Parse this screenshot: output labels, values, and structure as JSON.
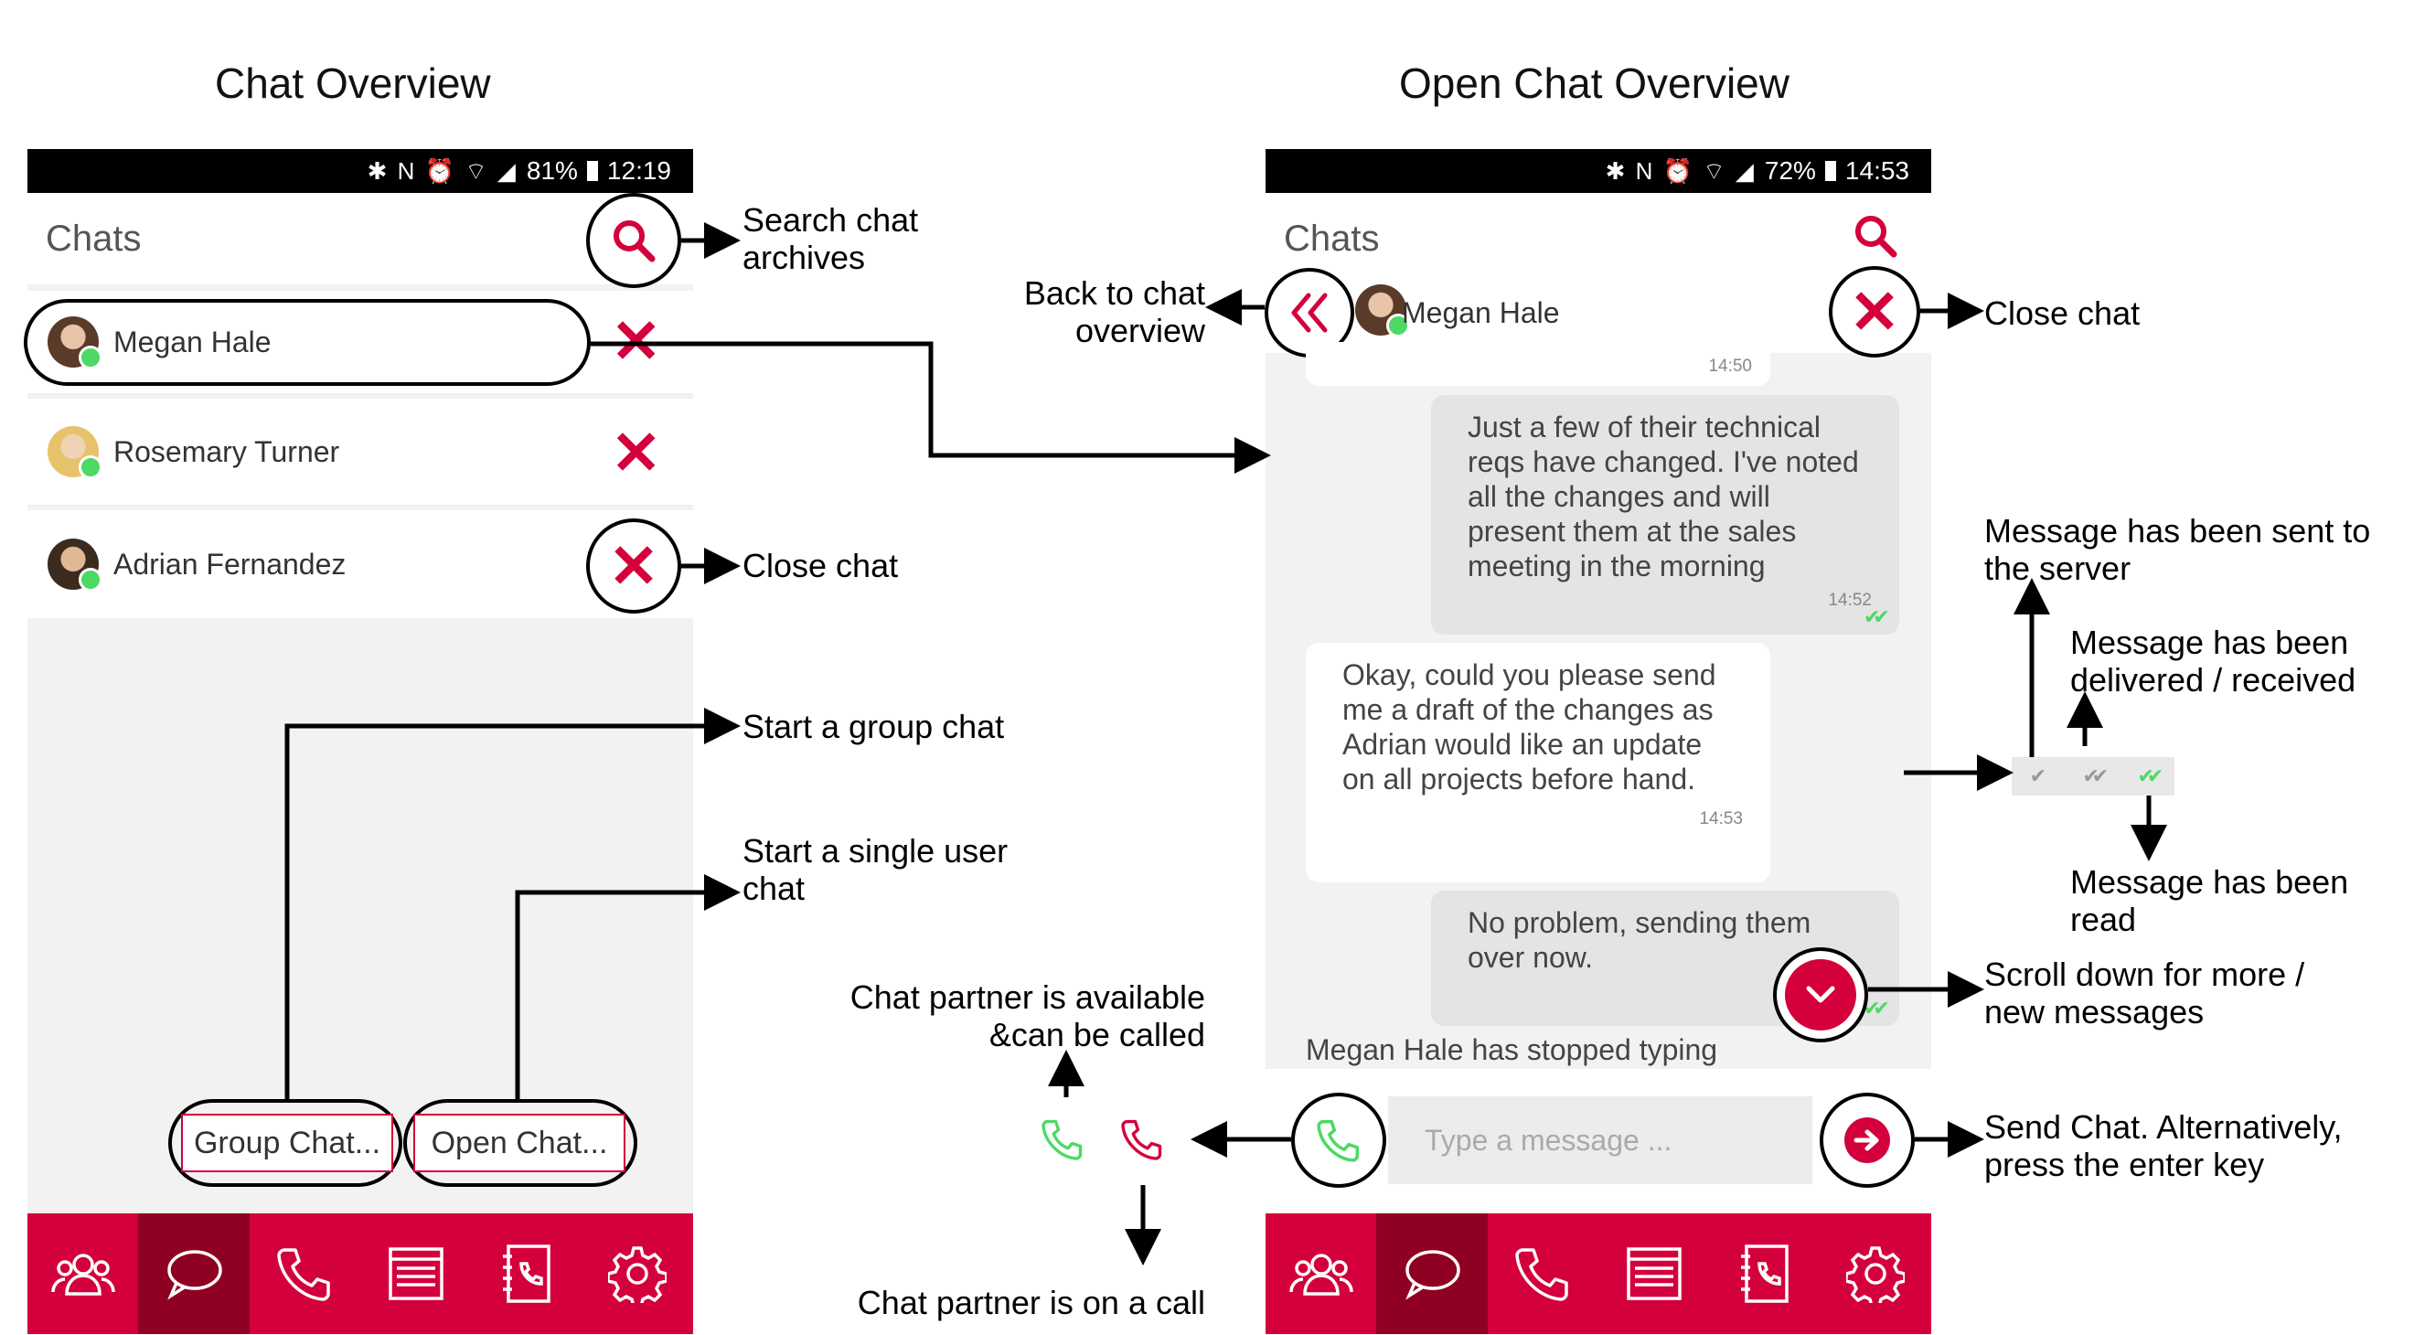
{
  "titles": {
    "left": "Chat Overview",
    "right": "Open Chat Overview"
  },
  "left_phone": {
    "status": {
      "icons": "✱ N ⏰ ⌔ ◢",
      "battery": "81%",
      "time": "12:19"
    },
    "header": "Chats",
    "chats": [
      {
        "name": "Megan Hale"
      },
      {
        "name": "Rosemary Turner"
      },
      {
        "name": "Adrian Fernandez"
      }
    ],
    "buttons": {
      "group": "Group Chat...",
      "open": "Open Chat..."
    }
  },
  "right_phone": {
    "status": {
      "icons": "✱ N ⏰ ⌔ ◢",
      "battery": "72%",
      "time": "14:53"
    },
    "header": "Chats",
    "contact": "Megan Hale",
    "messages": [
      {
        "text": "",
        "time": "14:50",
        "dir": "in"
      },
      {
        "text": "Just a few of their technical reqs have changed. I've noted all the changes and will present them at the sales meeting in the morning",
        "time": "14:52",
        "dir": "out"
      },
      {
        "text": "Okay, could you please send me a draft of the changes as Adrian would like an update on all projects before hand.",
        "time": "14:53",
        "dir": "in"
      },
      {
        "text": "No problem, sending them over now.",
        "time": "",
        "dir": "out"
      }
    ],
    "typing": "Megan Hale has stopped typing",
    "input_placeholder": "Type a message ..."
  },
  "annotations": {
    "search": "Search chat\narchives",
    "close_left": "Close chat",
    "group": "Start a group chat",
    "single": "Start a single user\nchat",
    "back": "Back to chat\noverview",
    "close_right": "Close chat",
    "sent_server": "Message has been sent to\nthe server",
    "delivered": "Message has been\ndelivered / received",
    "read": "Message has been\nread",
    "scroll": "Scroll down for more /\nnew messages",
    "send": "Send Chat. Alternatively,\npress the enter key",
    "available": "Chat partner is available\n&can be called",
    "on_call": "Chat partner is on a call"
  },
  "nav_icons": [
    "contacts-icon",
    "chat-icon",
    "phone-icon",
    "list-icon",
    "phonebook-icon",
    "settings-icon"
  ],
  "colors": {
    "brand": "#d4003b",
    "brand_dark": "#8f0022",
    "online": "#4cd964",
    "tick_green": "#4cd964",
    "tick_grey": "#999999"
  }
}
